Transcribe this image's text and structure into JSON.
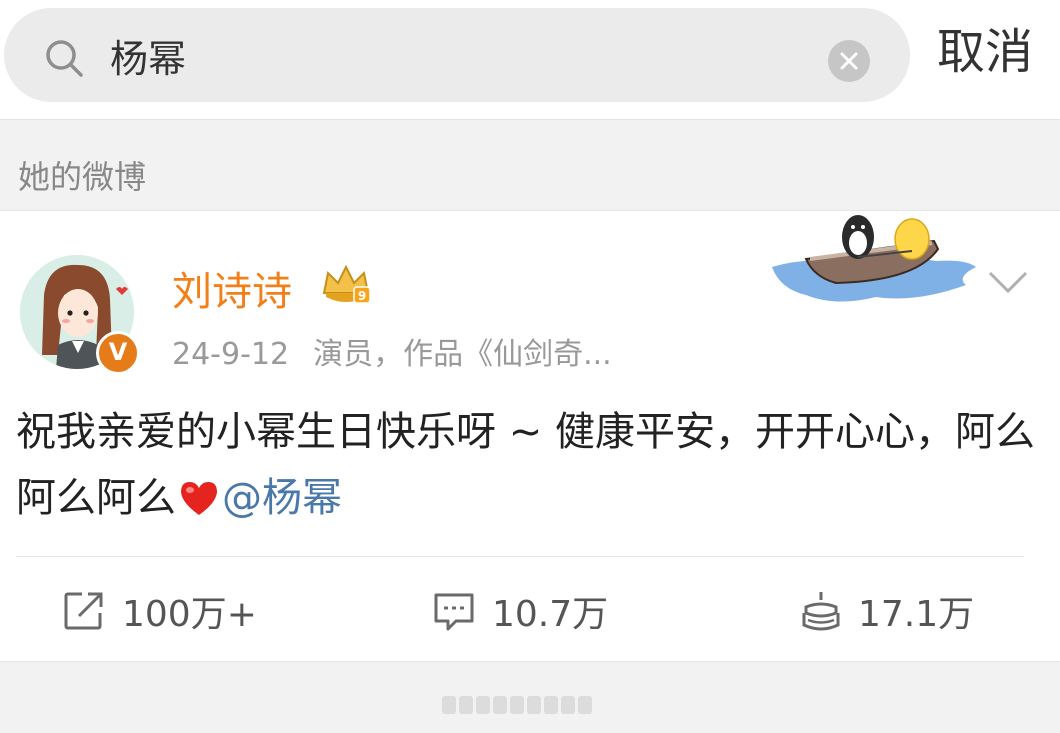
{
  "search": {
    "query": "杨幂",
    "cancel_label": "取消"
  },
  "section": {
    "label": "她的微博"
  },
  "post": {
    "author": "刘诗诗",
    "verify_mark": "V",
    "time": "24-9-12",
    "source": "演员，作品《仙剑奇...",
    "text": "祝我亲爱的小幂生日快乐呀 ~ 健康平安，开开心心，阿么阿么阿么",
    "mention": "@杨幂",
    "stats": {
      "reposts": "100万+",
      "comments": "10.7万",
      "likes": "17.1万"
    }
  },
  "colors": {
    "username": "#f27f17",
    "mention": "#4a78a8",
    "verify": "#e67b1a"
  },
  "icons": [
    "search-icon",
    "clear-icon",
    "vip-crown-icon",
    "chevron-down-icon",
    "heart-emoji-icon",
    "repost-icon",
    "comment-icon",
    "like-icon"
  ]
}
